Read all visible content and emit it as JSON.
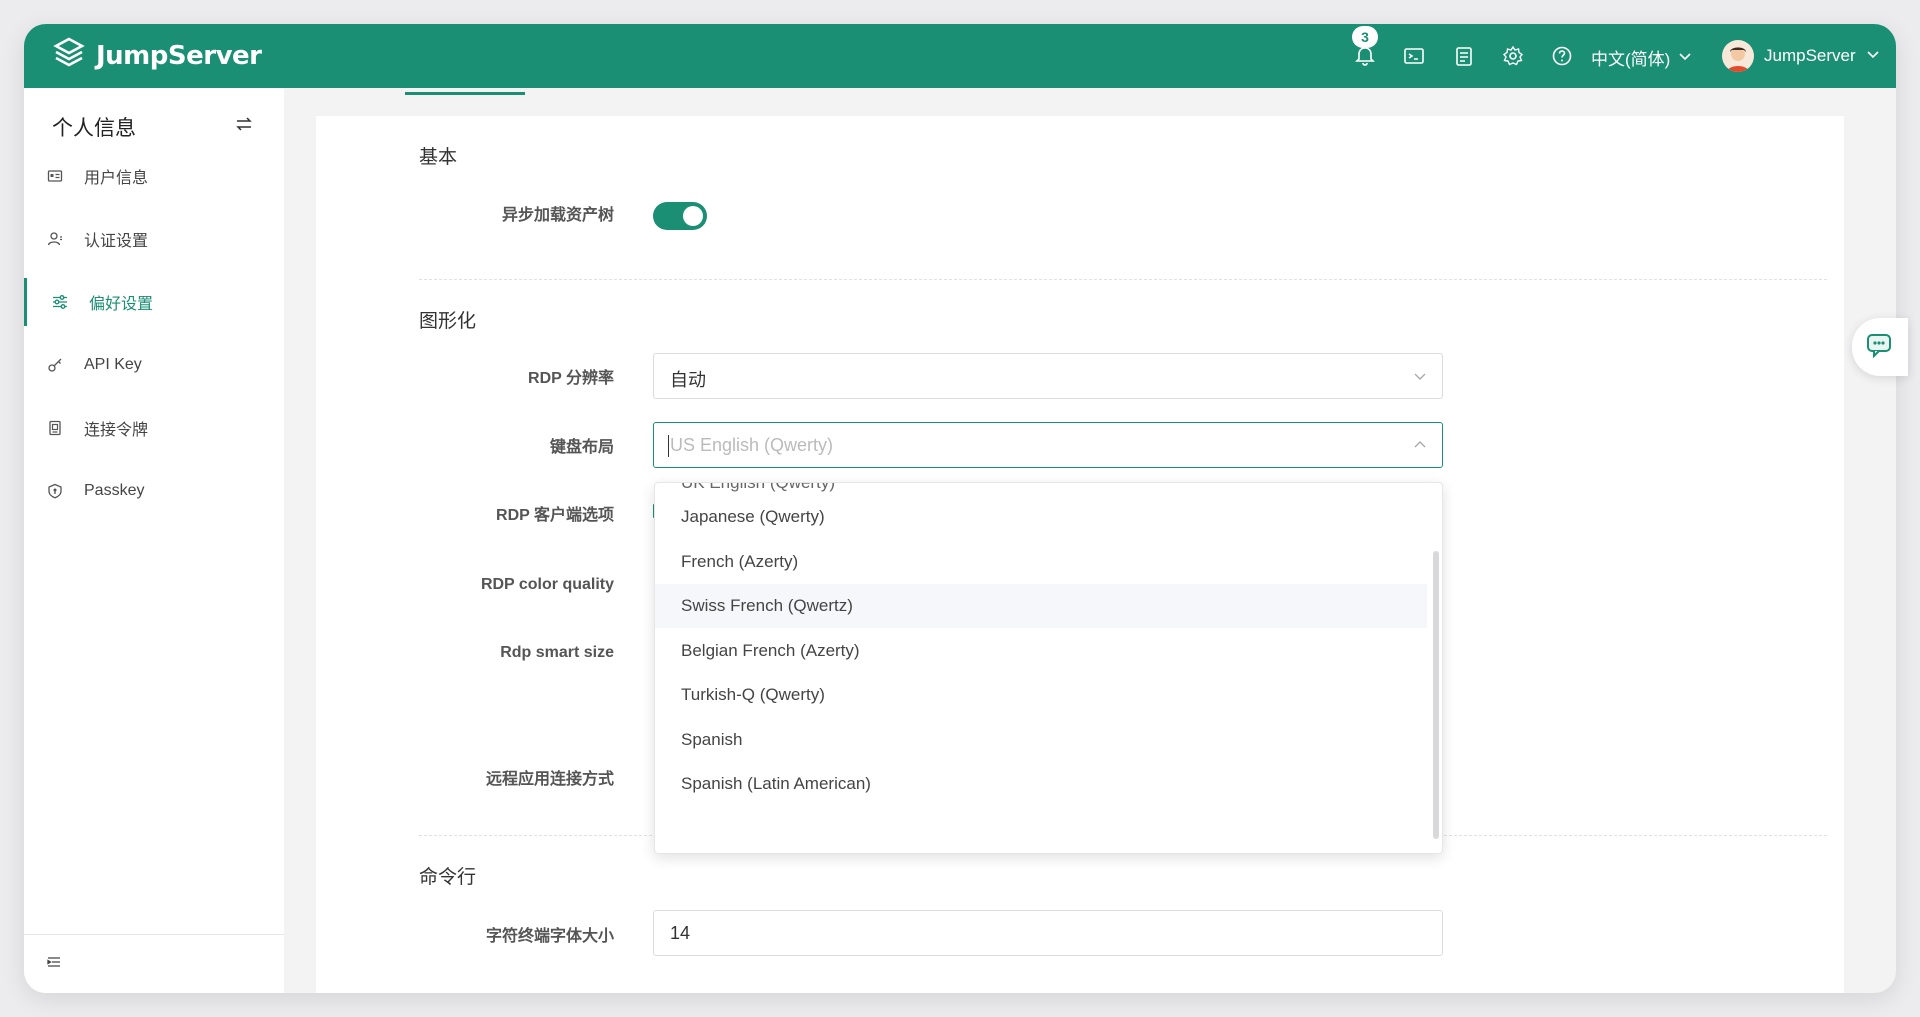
{
  "header": {
    "brand": "JumpServer",
    "notification_count": "3",
    "language": "中文(简体)",
    "username": "JumpServer",
    "accent_color": "#1a8f74"
  },
  "sidebar": {
    "title": "个人信息",
    "items": [
      {
        "label": "用户信息",
        "icon": "id-card-icon"
      },
      {
        "label": "认证设置",
        "icon": "user-icon"
      },
      {
        "label": "偏好设置",
        "icon": "sliders-icon",
        "active": true
      },
      {
        "label": "API Key",
        "icon": "key-icon"
      },
      {
        "label": "连接令牌",
        "icon": "token-icon"
      },
      {
        "label": "Passkey",
        "icon": "shield-icon"
      }
    ]
  },
  "sections": {
    "basic": {
      "title": "基本",
      "async_tree_label": "异步加载资产树",
      "async_tree_on": true
    },
    "graphical": {
      "title": "图形化",
      "rdp_resolution_label": "RDP 分辨率",
      "rdp_resolution_value": "自动",
      "keyboard_label": "键盘布局",
      "keyboard_placeholder": "US English (Qwerty)",
      "rdp_client_label": "RDP 客户端选项",
      "rdp_color_label": "RDP color quality",
      "rdp_smart_label": "Rdp smart size",
      "remote_app_label": "远程应用连接方式"
    },
    "cli": {
      "title": "命令行",
      "font_size_label": "字符终端字体大小",
      "font_size_value": "14"
    }
  },
  "keyboard_dropdown": {
    "partial_item": "UK English (Qwerty)",
    "options": [
      "Japanese (Qwerty)",
      "French (Azerty)",
      "Swiss French (Qwertz)",
      "Belgian French (Azerty)",
      "Turkish-Q (Qwerty)",
      "Spanish",
      "Spanish (Latin American)"
    ],
    "hovered": "Swiss French (Qwertz)"
  }
}
